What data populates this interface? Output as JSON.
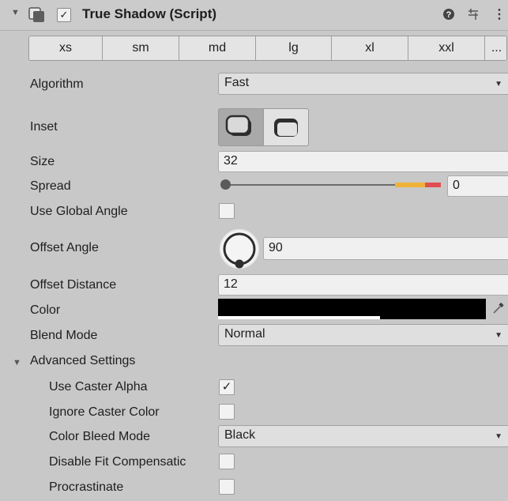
{
  "component": {
    "title": "True Shadow (Script)",
    "enabled": true,
    "fold_icon": "triangle-down-icon",
    "icon": "component-icon",
    "help_icon": "help-icon",
    "presets_icon": "presets-icon",
    "more_icon": "kebab-menu-icon",
    "more_label": "⋮"
  },
  "size_presets": {
    "items": [
      "xs",
      "sm",
      "md",
      "lg",
      "xl",
      "xxl"
    ],
    "more_label": "..."
  },
  "fields": {
    "algorithm": {
      "label": "Algorithm",
      "value": "Fast"
    },
    "inset": {
      "label": "Inset"
    },
    "size": {
      "label": "Size",
      "value": "32"
    },
    "spread": {
      "label": "Spread",
      "value": "0"
    },
    "use_global_angle": {
      "label": "Use Global Angle",
      "checked": false
    },
    "offset_angle": {
      "label": "Offset Angle",
      "value": "90"
    },
    "offset_distance": {
      "label": "Offset Distance",
      "value": "12"
    },
    "color": {
      "label": "Color",
      "value": "#000000",
      "picker_icon": "eyedropper-icon"
    },
    "blend_mode": {
      "label": "Blend Mode",
      "value": "Normal"
    }
  },
  "advanced": {
    "label": "Advanced Settings",
    "expanded": true,
    "use_caster_alpha": {
      "label": "Use Caster Alpha",
      "checked": true
    },
    "ignore_caster_color": {
      "label": "Ignore Caster Color",
      "checked": false
    },
    "color_bleed_mode": {
      "label": "Color Bleed Mode",
      "value": "Black"
    },
    "disable_fit_compensation": {
      "label": "Disable Fit Compensatic",
      "checked": false
    },
    "procrastinate": {
      "label": "Procrastinate",
      "checked": false
    }
  },
  "glyphs": {
    "dropdown_arrow": "▼",
    "fold_open": "▼",
    "check": "✓"
  },
  "colors": {
    "panel_bg": "#c8c8c8",
    "slider_highlight": "#f0b33a",
    "slider_red": "#e05050"
  }
}
